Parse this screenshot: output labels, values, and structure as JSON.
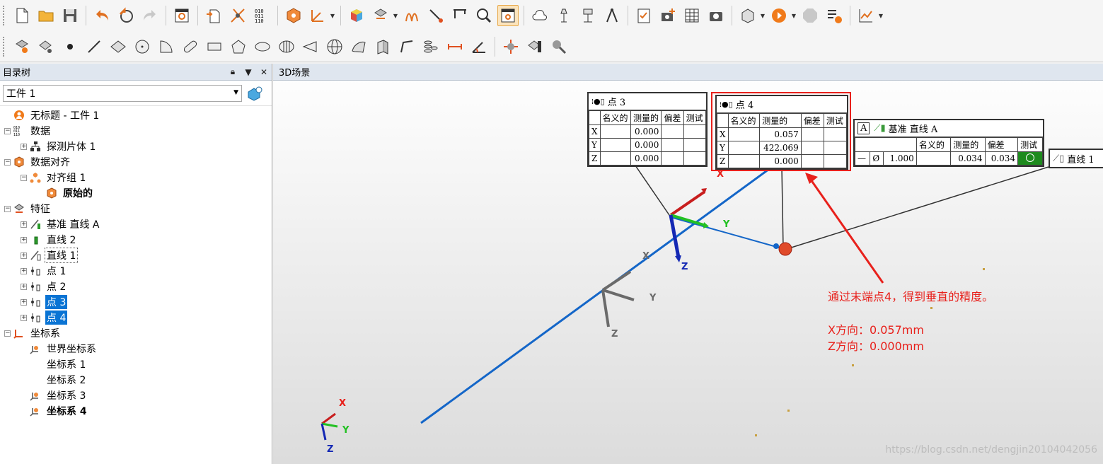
{
  "toolbar1": {
    "buttons": [
      "new-file",
      "open-folder",
      "save",
      "undo",
      "redo-faded",
      "redo",
      "settings",
      "import",
      "laser",
      "binary-data",
      "align-cube",
      "measure-axes",
      "color-cube",
      "scan-grid",
      "curve-tool",
      "probe",
      "caliper",
      "zoom-a1",
      "view-grid-active",
      "cloud",
      "probe-stand",
      "probe-stand-2",
      "compass",
      "checklist",
      "camera-add",
      "table",
      "camera",
      "export",
      "play",
      "stop",
      "run-list",
      "chart"
    ]
  },
  "toolbar2": {
    "buttons": [
      "point-cloud-feature",
      "grid-point",
      "point",
      "line",
      "plane",
      "circle",
      "arc",
      "slot",
      "rectangle",
      "polygon",
      "ellipse",
      "cylinder",
      "cone",
      "sphere",
      "surface",
      "plane-2",
      "polyline",
      "stack",
      "distance",
      "angle",
      "crosshair",
      "grid-feature",
      "wrench"
    ]
  },
  "panel": {
    "title": "目录树",
    "part_value": "工件 1",
    "tree": [
      {
        "label": "无标题 - 工件 1",
        "icon": "root-icon",
        "level": 0
      },
      {
        "label": "数据",
        "icon": "binary-icon",
        "level": 0,
        "exp": "-"
      },
      {
        "label": "探测片体 1",
        "icon": "hierarchy-icon",
        "level": 1,
        "exp": "+"
      },
      {
        "label": "数据对齐",
        "icon": "align-icon",
        "level": 0,
        "exp": "-"
      },
      {
        "label": "对齐组 1",
        "icon": "group-icon",
        "level": 1,
        "exp": "-"
      },
      {
        "label": "原始的",
        "icon": "align-icon",
        "level": 2,
        "bold": true
      },
      {
        "label": "特征",
        "icon": "feature-icon",
        "level": 0,
        "exp": "-"
      },
      {
        "label": "基准 直线 A",
        "icon": "datum-line-icon",
        "level": 1,
        "exp": "+"
      },
      {
        "label": "直线 2",
        "icon": "line-bar-icon",
        "level": 1,
        "exp": "+"
      },
      {
        "label": "直线 1",
        "icon": "line-icon",
        "level": 1,
        "exp": "+",
        "focus": true
      },
      {
        "label": "点 1",
        "icon": "point-icon",
        "level": 1,
        "exp": "+"
      },
      {
        "label": "点 2",
        "icon": "point-icon",
        "level": 1,
        "exp": "+"
      },
      {
        "label": "点 3",
        "icon": "point-icon",
        "level": 1,
        "exp": "+",
        "sel": true
      },
      {
        "label": "点 4",
        "icon": "point-icon",
        "level": 1,
        "exp": "+",
        "sel": true
      },
      {
        "label": "坐标系",
        "icon": "coord-icon",
        "level": 0,
        "exp": "-"
      },
      {
        "label": "世界坐标系",
        "icon": "coord-sys-icon",
        "level": 1
      },
      {
        "label": "坐标系 1",
        "icon": "",
        "level": 1
      },
      {
        "label": "坐标系 2",
        "icon": "",
        "level": 1
      },
      {
        "label": "坐标系 3",
        "icon": "coord-sys-icon",
        "level": 1
      },
      {
        "label": "坐标系 4",
        "icon": "coord-sys-icon",
        "level": 1,
        "bold": true
      }
    ]
  },
  "viewport": {
    "title": "3D场景",
    "point3": {
      "title": "点 3",
      "headers": [
        "名义的",
        "测量的",
        "偏差",
        "测试"
      ],
      "rows": [
        {
          "axis": "X",
          "nominal": "",
          "measured": "0.000",
          "dev": "",
          "test": ""
        },
        {
          "axis": "Y",
          "nominal": "",
          "measured": "0.000",
          "dev": "",
          "test": ""
        },
        {
          "axis": "Z",
          "nominal": "",
          "measured": "0.000",
          "dev": "",
          "test": ""
        }
      ]
    },
    "point4": {
      "title": "点 4",
      "headers": [
        "名义的",
        "测量的",
        "偏差",
        "测试"
      ],
      "rows": [
        {
          "axis": "X",
          "nominal": "",
          "measured": "0.057",
          "dev": "",
          "test": ""
        },
        {
          "axis": "Y",
          "nominal": "",
          "measured": "422.069",
          "dev": "",
          "test": ""
        },
        {
          "axis": "Z",
          "nominal": "",
          "measured": "0.000",
          "dev": "",
          "test": ""
        }
      ]
    },
    "datum": {
      "letter": "A",
      "title": "基准 直线 A",
      "headers": [
        "名义的",
        "测量的",
        "偏差",
        "测试"
      ],
      "symbol1": "—",
      "symbol2": "Ø",
      "tol": "1.000",
      "measured": "0.034",
      "dev": "0.034"
    },
    "line1_label": "直线 1",
    "axes": {
      "x": "X",
      "y": "Y",
      "z": "Z"
    },
    "annotation": {
      "line1": "通过末端点4，得到垂直的精度。",
      "line2": "X方向：0.057mm",
      "line3": "Z方向：0.000mm"
    },
    "watermark": "https://blog.csdn.net/dengjin20104042056",
    "colors": {
      "accent_red": "#e8211c",
      "line_blue": "#1466c8",
      "pass_green": "#1e8a1e"
    }
  }
}
